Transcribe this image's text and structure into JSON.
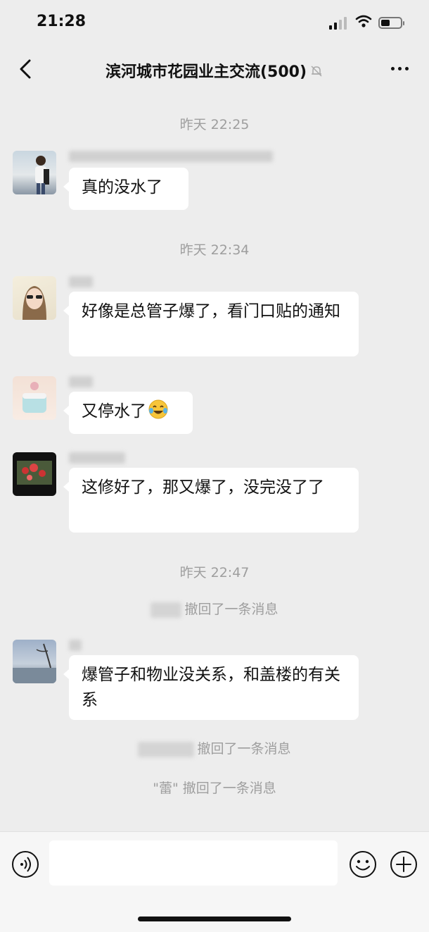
{
  "status_bar": {
    "time": "21:28"
  },
  "header": {
    "title": "滨河城市花园业主交流(500)",
    "back_icon": "chevron-left-icon",
    "mute_icon": "bell-off-icon",
    "more_icon": "more-dots-icon"
  },
  "chat": {
    "timestamps": [
      "昨天 22:25",
      "昨天 22:34",
      "昨天 22:47"
    ],
    "messages": [
      {
        "text": "真的没水了"
      },
      {
        "text": "好像是总管子爆了，看门口贴的通知"
      },
      {
        "text": "又停水了"
      },
      {
        "text": "这修好了，那又爆了，没完没了了"
      },
      {
        "text": "爆管子和物业没关系，和盖楼的有关系"
      }
    ],
    "recalls": [
      {
        "text": "撤回了一条消息"
      },
      {
        "text": "撤回了一条消息"
      },
      {
        "name": "\"蕾\"",
        "text": "撤回了一条消息"
      }
    ]
  },
  "input_bar": {
    "placeholder": "",
    "voice_icon": "voice-icon",
    "emoji_icon": "emoji-icon",
    "plus_icon": "plus-icon"
  },
  "colors": {
    "background": "#ededed",
    "bubble": "#ffffff",
    "system_text": "#9e9e9e"
  }
}
